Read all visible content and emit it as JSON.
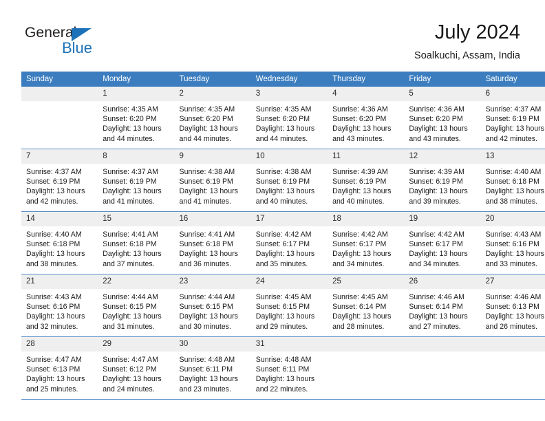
{
  "brand": {
    "name_part1": "General",
    "name_part2": "Blue",
    "logo_icon": "triangle-icon",
    "accent_color": "#1c72b8"
  },
  "header": {
    "title": "July 2024",
    "location": "Soalkuchi, Assam, India"
  },
  "theme": {
    "header_row_bg": "#3b7dbf",
    "daynum_bg": "#efefef",
    "row_divider": "#5b90c9"
  },
  "weekdays": [
    "Sunday",
    "Monday",
    "Tuesday",
    "Wednesday",
    "Thursday",
    "Friday",
    "Saturday"
  ],
  "weeks": [
    [
      {
        "day": "",
        "empty": true
      },
      {
        "day": "1",
        "sunrise": "Sunrise: 4:35 AM",
        "sunset": "Sunset: 6:20 PM",
        "daylight_line1": "Daylight: 13 hours",
        "daylight_line2": "and 44 minutes."
      },
      {
        "day": "2",
        "sunrise": "Sunrise: 4:35 AM",
        "sunset": "Sunset: 6:20 PM",
        "daylight_line1": "Daylight: 13 hours",
        "daylight_line2": "and 44 minutes."
      },
      {
        "day": "3",
        "sunrise": "Sunrise: 4:35 AM",
        "sunset": "Sunset: 6:20 PM",
        "daylight_line1": "Daylight: 13 hours",
        "daylight_line2": "and 44 minutes."
      },
      {
        "day": "4",
        "sunrise": "Sunrise: 4:36 AM",
        "sunset": "Sunset: 6:20 PM",
        "daylight_line1": "Daylight: 13 hours",
        "daylight_line2": "and 43 minutes."
      },
      {
        "day": "5",
        "sunrise": "Sunrise: 4:36 AM",
        "sunset": "Sunset: 6:20 PM",
        "daylight_line1": "Daylight: 13 hours",
        "daylight_line2": "and 43 minutes."
      },
      {
        "day": "6",
        "sunrise": "Sunrise: 4:37 AM",
        "sunset": "Sunset: 6:19 PM",
        "daylight_line1": "Daylight: 13 hours",
        "daylight_line2": "and 42 minutes."
      }
    ],
    [
      {
        "day": "7",
        "sunrise": "Sunrise: 4:37 AM",
        "sunset": "Sunset: 6:19 PM",
        "daylight_line1": "Daylight: 13 hours",
        "daylight_line2": "and 42 minutes."
      },
      {
        "day": "8",
        "sunrise": "Sunrise: 4:37 AM",
        "sunset": "Sunset: 6:19 PM",
        "daylight_line1": "Daylight: 13 hours",
        "daylight_line2": "and 41 minutes."
      },
      {
        "day": "9",
        "sunrise": "Sunrise: 4:38 AM",
        "sunset": "Sunset: 6:19 PM",
        "daylight_line1": "Daylight: 13 hours",
        "daylight_line2": "and 41 minutes."
      },
      {
        "day": "10",
        "sunrise": "Sunrise: 4:38 AM",
        "sunset": "Sunset: 6:19 PM",
        "daylight_line1": "Daylight: 13 hours",
        "daylight_line2": "and 40 minutes."
      },
      {
        "day": "11",
        "sunrise": "Sunrise: 4:39 AM",
        "sunset": "Sunset: 6:19 PM",
        "daylight_line1": "Daylight: 13 hours",
        "daylight_line2": "and 40 minutes."
      },
      {
        "day": "12",
        "sunrise": "Sunrise: 4:39 AM",
        "sunset": "Sunset: 6:19 PM",
        "daylight_line1": "Daylight: 13 hours",
        "daylight_line2": "and 39 minutes."
      },
      {
        "day": "13",
        "sunrise": "Sunrise: 4:40 AM",
        "sunset": "Sunset: 6:18 PM",
        "daylight_line1": "Daylight: 13 hours",
        "daylight_line2": "and 38 minutes."
      }
    ],
    [
      {
        "day": "14",
        "sunrise": "Sunrise: 4:40 AM",
        "sunset": "Sunset: 6:18 PM",
        "daylight_line1": "Daylight: 13 hours",
        "daylight_line2": "and 38 minutes."
      },
      {
        "day": "15",
        "sunrise": "Sunrise: 4:41 AM",
        "sunset": "Sunset: 6:18 PM",
        "daylight_line1": "Daylight: 13 hours",
        "daylight_line2": "and 37 minutes."
      },
      {
        "day": "16",
        "sunrise": "Sunrise: 4:41 AM",
        "sunset": "Sunset: 6:18 PM",
        "daylight_line1": "Daylight: 13 hours",
        "daylight_line2": "and 36 minutes."
      },
      {
        "day": "17",
        "sunrise": "Sunrise: 4:42 AM",
        "sunset": "Sunset: 6:17 PM",
        "daylight_line1": "Daylight: 13 hours",
        "daylight_line2": "and 35 minutes."
      },
      {
        "day": "18",
        "sunrise": "Sunrise: 4:42 AM",
        "sunset": "Sunset: 6:17 PM",
        "daylight_line1": "Daylight: 13 hours",
        "daylight_line2": "and 34 minutes."
      },
      {
        "day": "19",
        "sunrise": "Sunrise: 4:42 AM",
        "sunset": "Sunset: 6:17 PM",
        "daylight_line1": "Daylight: 13 hours",
        "daylight_line2": "and 34 minutes."
      },
      {
        "day": "20",
        "sunrise": "Sunrise: 4:43 AM",
        "sunset": "Sunset: 6:16 PM",
        "daylight_line1": "Daylight: 13 hours",
        "daylight_line2": "and 33 minutes."
      }
    ],
    [
      {
        "day": "21",
        "sunrise": "Sunrise: 4:43 AM",
        "sunset": "Sunset: 6:16 PM",
        "daylight_line1": "Daylight: 13 hours",
        "daylight_line2": "and 32 minutes."
      },
      {
        "day": "22",
        "sunrise": "Sunrise: 4:44 AM",
        "sunset": "Sunset: 6:15 PM",
        "daylight_line1": "Daylight: 13 hours",
        "daylight_line2": "and 31 minutes."
      },
      {
        "day": "23",
        "sunrise": "Sunrise: 4:44 AM",
        "sunset": "Sunset: 6:15 PM",
        "daylight_line1": "Daylight: 13 hours",
        "daylight_line2": "and 30 minutes."
      },
      {
        "day": "24",
        "sunrise": "Sunrise: 4:45 AM",
        "sunset": "Sunset: 6:15 PM",
        "daylight_line1": "Daylight: 13 hours",
        "daylight_line2": "and 29 minutes."
      },
      {
        "day": "25",
        "sunrise": "Sunrise: 4:45 AM",
        "sunset": "Sunset: 6:14 PM",
        "daylight_line1": "Daylight: 13 hours",
        "daylight_line2": "and 28 minutes."
      },
      {
        "day": "26",
        "sunrise": "Sunrise: 4:46 AM",
        "sunset": "Sunset: 6:14 PM",
        "daylight_line1": "Daylight: 13 hours",
        "daylight_line2": "and 27 minutes."
      },
      {
        "day": "27",
        "sunrise": "Sunrise: 4:46 AM",
        "sunset": "Sunset: 6:13 PM",
        "daylight_line1": "Daylight: 13 hours",
        "daylight_line2": "and 26 minutes."
      }
    ],
    [
      {
        "day": "28",
        "sunrise": "Sunrise: 4:47 AM",
        "sunset": "Sunset: 6:13 PM",
        "daylight_line1": "Daylight: 13 hours",
        "daylight_line2": "and 25 minutes."
      },
      {
        "day": "29",
        "sunrise": "Sunrise: 4:47 AM",
        "sunset": "Sunset: 6:12 PM",
        "daylight_line1": "Daylight: 13 hours",
        "daylight_line2": "and 24 minutes."
      },
      {
        "day": "30",
        "sunrise": "Sunrise: 4:48 AM",
        "sunset": "Sunset: 6:11 PM",
        "daylight_line1": "Daylight: 13 hours",
        "daylight_line2": "and 23 minutes."
      },
      {
        "day": "31",
        "sunrise": "Sunrise: 4:48 AM",
        "sunset": "Sunset: 6:11 PM",
        "daylight_line1": "Daylight: 13 hours",
        "daylight_line2": "and 22 minutes."
      },
      {
        "day": "",
        "empty": true
      },
      {
        "day": "",
        "empty": true
      },
      {
        "day": "",
        "empty": true
      }
    ]
  ]
}
